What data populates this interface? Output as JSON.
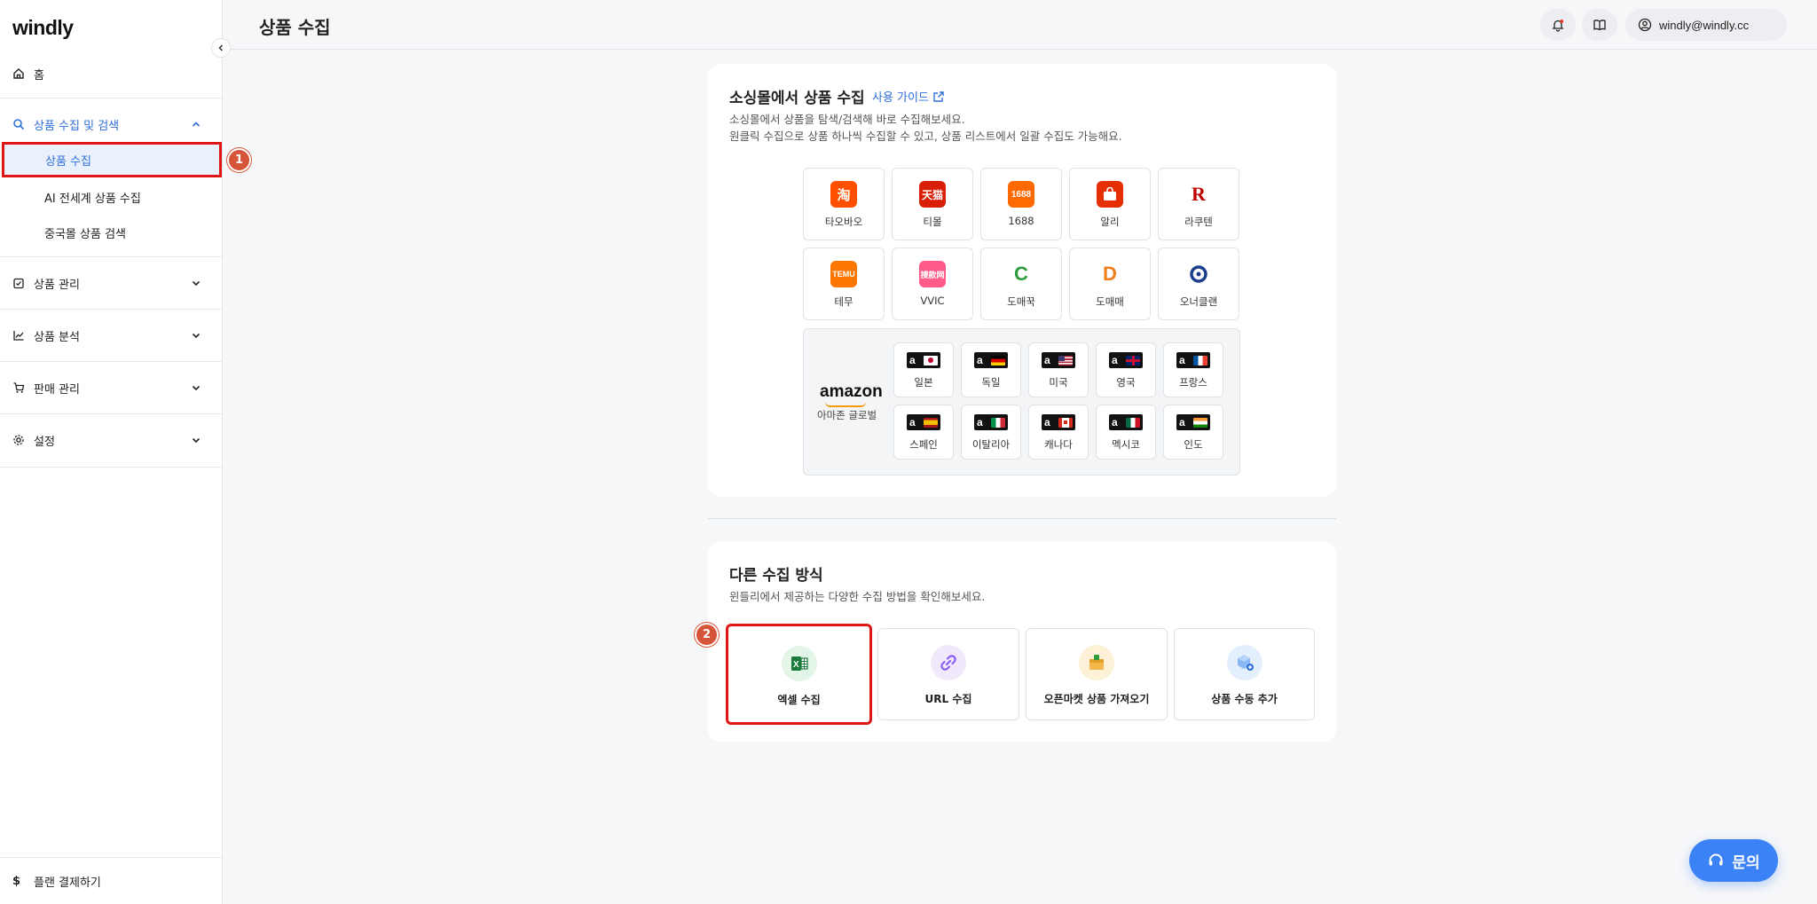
{
  "app": {
    "logo": "windly"
  },
  "sidebar": {
    "home": "홈",
    "groups": [
      {
        "label": "상품 수집 및 검색",
        "expanded": true,
        "items": [
          "상품 수집",
          "AI 전세계 상품 수집",
          "중국몰 상품 검색"
        ]
      },
      {
        "label": "상품 관리"
      },
      {
        "label": "상품 분석"
      },
      {
        "label": "판매 관리"
      },
      {
        "label": "설정"
      }
    ],
    "plan": "플랜 결제하기"
  },
  "header": {
    "title": "상품 수집",
    "user": "windly@windly.cc"
  },
  "social_collect": {
    "title": "소싱몰에서 상품 수집",
    "guide_link": "사용 가이드",
    "desc1": "소싱몰에서 상품을 탐색/검색해 바로 수집해보세요.",
    "desc2": "원클릭 수집으로 상품 하나씩 수집할 수 있고, 상품 리스트에서 일괄 수집도 가능해요.",
    "malls": [
      "타오바오",
      "티몰",
      "1688",
      "알리",
      "라쿠텐",
      "테무",
      "VVIC",
      "도매꾹",
      "도매매",
      "오너클랜"
    ],
    "amazon": {
      "logo": "amazon",
      "label": "아마존 글로벌",
      "countries": [
        "일본",
        "독일",
        "미국",
        "영국",
        "프랑스",
        "스페인",
        "이탈리아",
        "캐나다",
        "멕시코",
        "인도"
      ]
    }
  },
  "other_methods": {
    "title": "다른 수집 방식",
    "desc": "윈들리에서 제공하는 다양한 수집 방법을 확인해보세요.",
    "methods": [
      "엑셀 수집",
      "URL 수집",
      "오픈마켓 상품 가져오기",
      "상품 수동 추가"
    ]
  },
  "steps": [
    "1",
    "2"
  ],
  "help": {
    "label": "문의"
  },
  "colors": {
    "accent": "#2f6fd8",
    "highlight": "#e01616",
    "badge": "#d6543a"
  }
}
